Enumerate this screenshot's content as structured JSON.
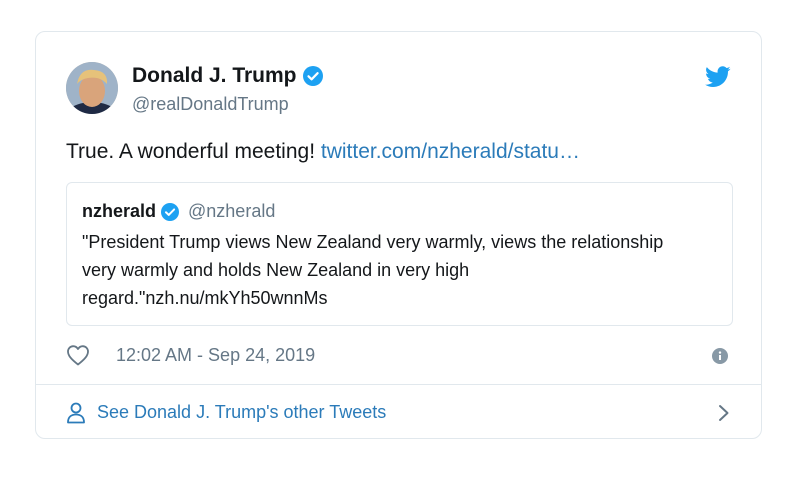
{
  "tweet": {
    "author": {
      "display_name": "Donald J. Trump",
      "handle": "@realDonaldTrump"
    },
    "text": "True. A wonderful meeting!",
    "link_text": "twitter.com/nzherald/statu…",
    "quoted": {
      "name": "nzherald",
      "handle": "@nzherald",
      "text": "\"President Trump views New Zealand very warmly, views the relationship very warmly and holds New Zealand in very high regard.\"nzh.nu/mkYh50wnnMs"
    },
    "timestamp": "12:02 AM - Sep 24, 2019",
    "footer_link": "See Donald J. Trump's other Tweets"
  },
  "icons": {
    "verified": "verified-badge-icon",
    "brand": "twitter-bird-icon",
    "like": "heart-icon",
    "info": "info-icon",
    "profile": "person-icon",
    "chevron": "chevron-right-icon"
  },
  "colors": {
    "accent": "#1da1f2",
    "link": "#2b7bb9",
    "muted": "#657786",
    "border": "#e1e8ed"
  }
}
